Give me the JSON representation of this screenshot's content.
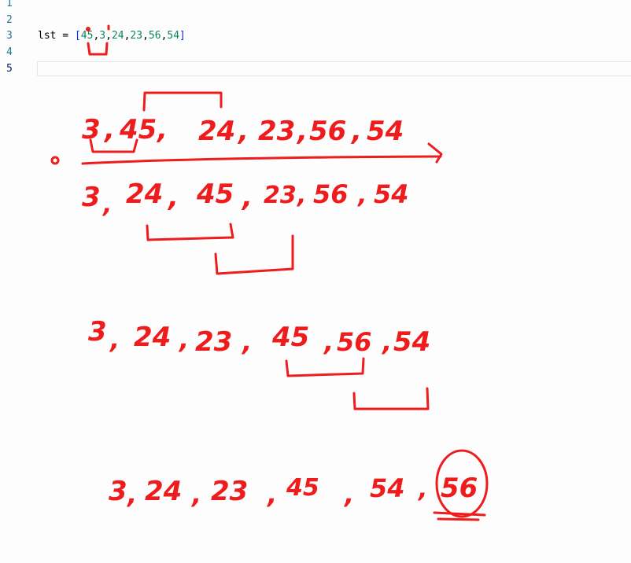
{
  "editor": {
    "line_numbers": [
      "1",
      "2",
      "3",
      "4",
      "5"
    ],
    "code": {
      "var": "lst",
      "op": " = ",
      "open": "[",
      "values": [
        "45",
        "3",
        "24",
        "23",
        "56",
        "54"
      ],
      "close": "]"
    }
  },
  "annotations": {
    "row1": [
      "3",
      "45",
      "24",
      "23",
      "56",
      "54"
    ],
    "row2": [
      "3",
      "24",
      "45",
      "23",
      "56",
      "54"
    ],
    "row3": [
      "3",
      "24",
      "23",
      "45",
      "56",
      "54"
    ],
    "row4": [
      "3",
      "24",
      "23",
      "45",
      "54",
      "56"
    ],
    "ink_color": "#ee1c1c"
  }
}
